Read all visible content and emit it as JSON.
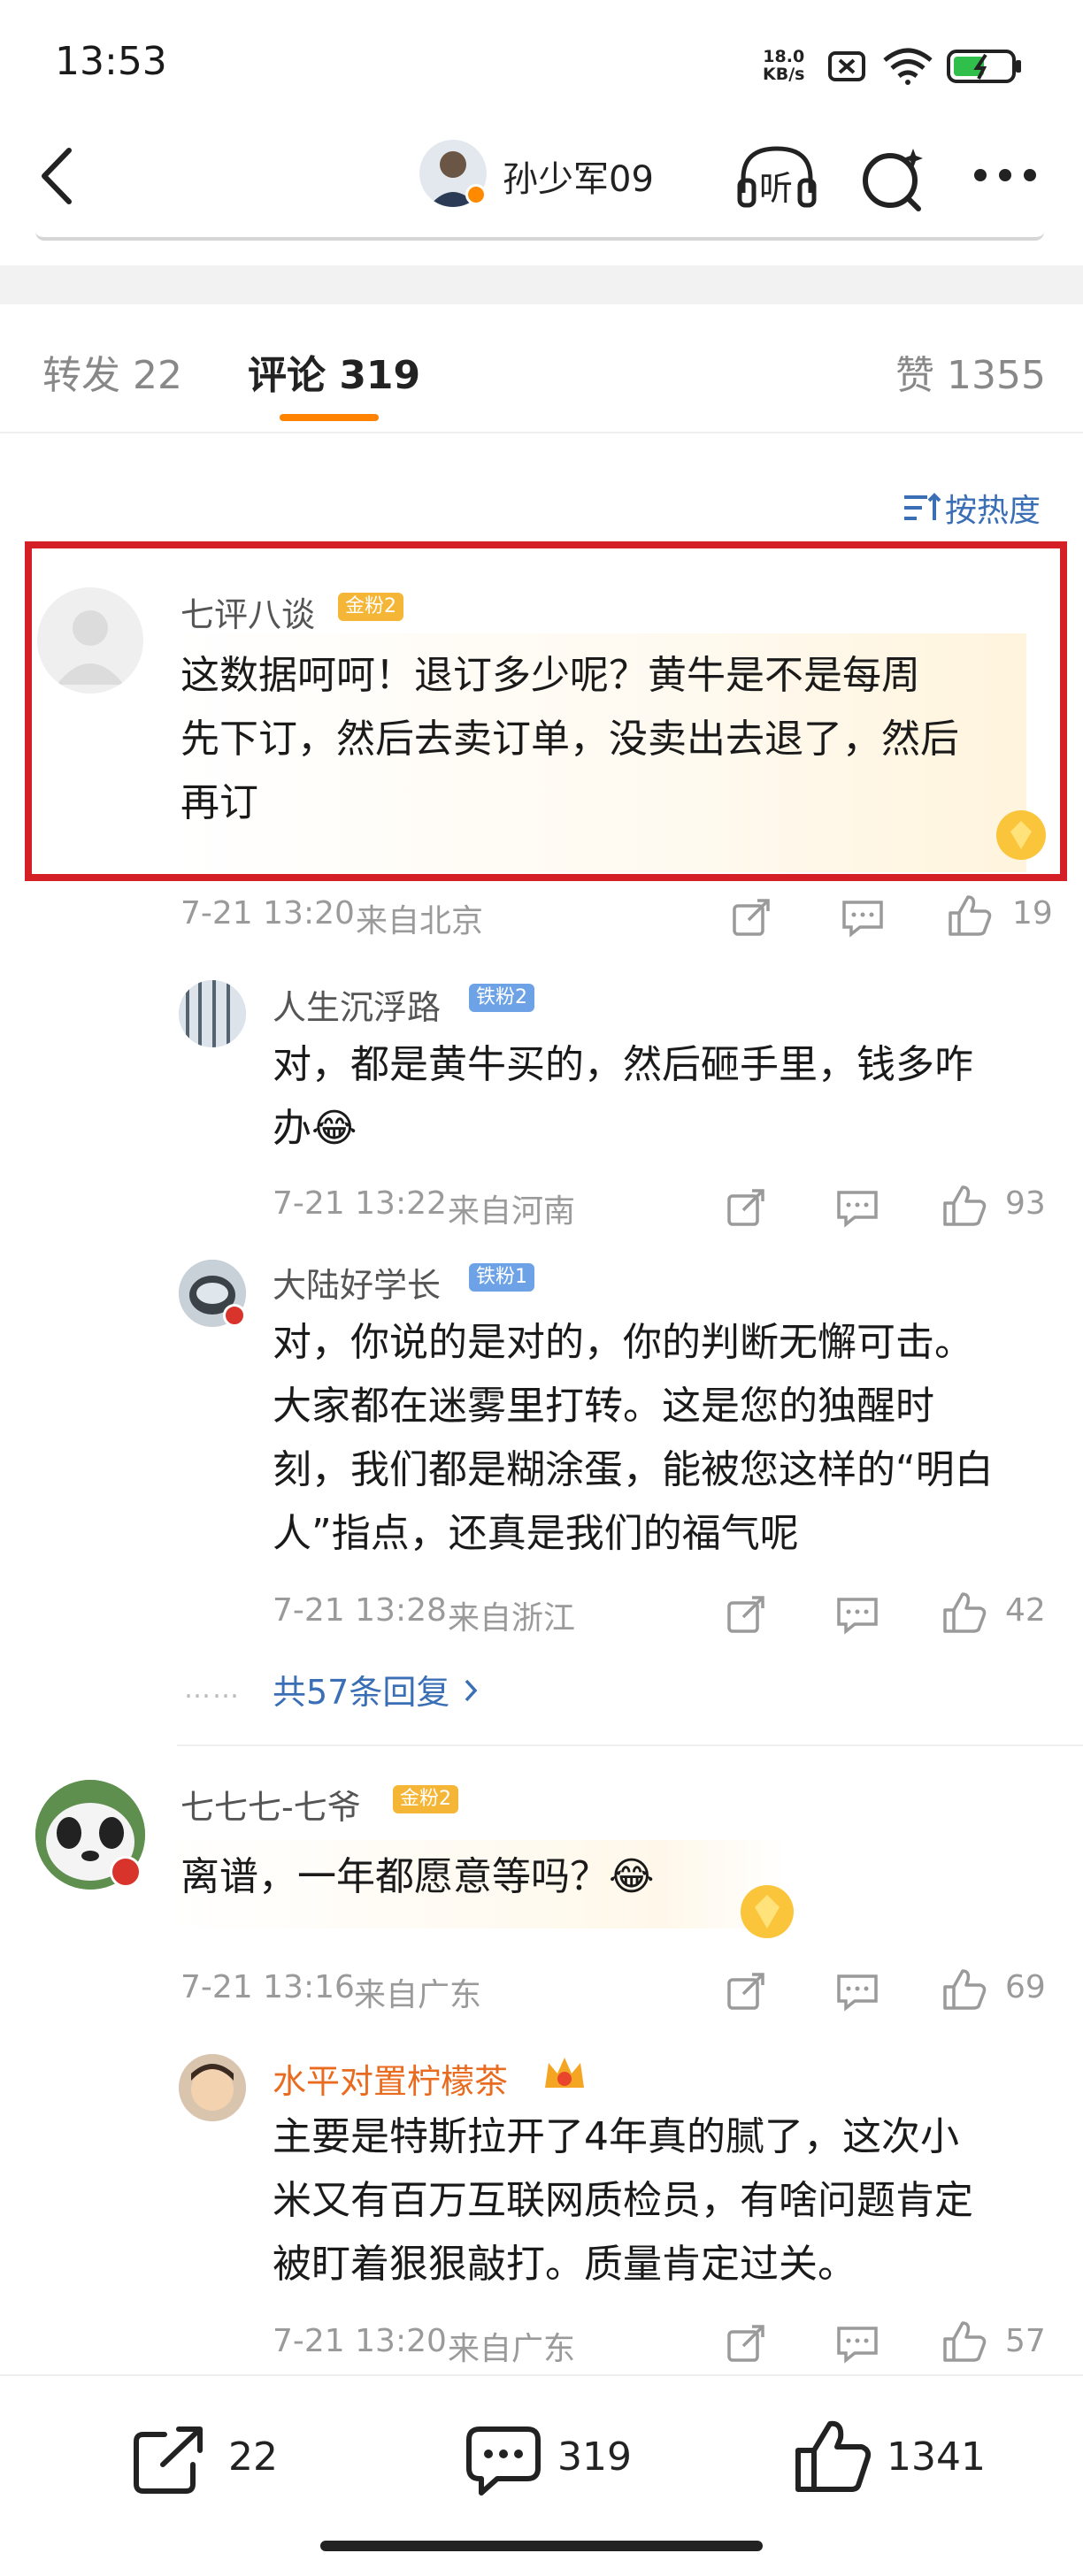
{
  "status_bar": {
    "time": "13:53",
    "net_speed": "18.0",
    "net_unit": "KB/s"
  },
  "navbar": {
    "user_name": "孙少军09",
    "listen_label": "听"
  },
  "tabs": {
    "repost": "转发 22",
    "comments": "评论 319",
    "likes": "赞 1355"
  },
  "sort_label": "按热度",
  "comments": [
    {
      "name": "七评八谈",
      "badge": "金粉2",
      "text_lines": [
        "这数据呵呵！退订多少呢？黄牛是不是每周",
        "先下订，然后去卖订单，没卖出去退了，然后",
        "再订"
      ],
      "time": "7-21 13:20",
      "location": "来自北京",
      "likes": "19"
    },
    {
      "name": "人生沉浮路",
      "badge": "铁粉2",
      "text_lines": [
        "对，都是黄牛买的，然后砸手里，钱多咋",
        "办😂"
      ],
      "time": "7-21 13:22",
      "location": "来自河南",
      "likes": "93"
    },
    {
      "name": "大陆好学长",
      "badge": "铁粉1",
      "text_lines": [
        "对，你说的是对的，你的判断无懈可击。",
        "大家都在迷雾里打转。这是您的独醒时",
        "刻，我们都是糊涂蛋，能被您这样的“明白",
        "人”指点，还真是我们的福气呢"
      ],
      "time": "7-21 13:28",
      "location": "来自浙江",
      "likes": "42"
    },
    {
      "name": "七七七-七爷",
      "badge": "金粉2",
      "text_lines": [
        "离谱，一年都愿意等吗？😂"
      ],
      "time": "7-21 13:16",
      "location": "来自广东",
      "likes": "69"
    },
    {
      "name": "水平对置柠檬茶",
      "badge": "",
      "text_lines": [
        "主要是特斯拉开了4年真的腻了，这次小",
        "米又有百万互联网质检员，有啥问题肯定",
        "被盯着狠狠敲打。质量肯定过关。"
      ],
      "time": "7-21 13:20",
      "location": "来自广东",
      "likes": "57"
    }
  ],
  "more_replies": "共57条回复",
  "bottom_bar": {
    "reposts": "22",
    "comments": "319",
    "likes": "1341"
  },
  "colors": {
    "accent": "#ff8200",
    "link": "#3a6eb5",
    "highlight": "#d41f26"
  }
}
